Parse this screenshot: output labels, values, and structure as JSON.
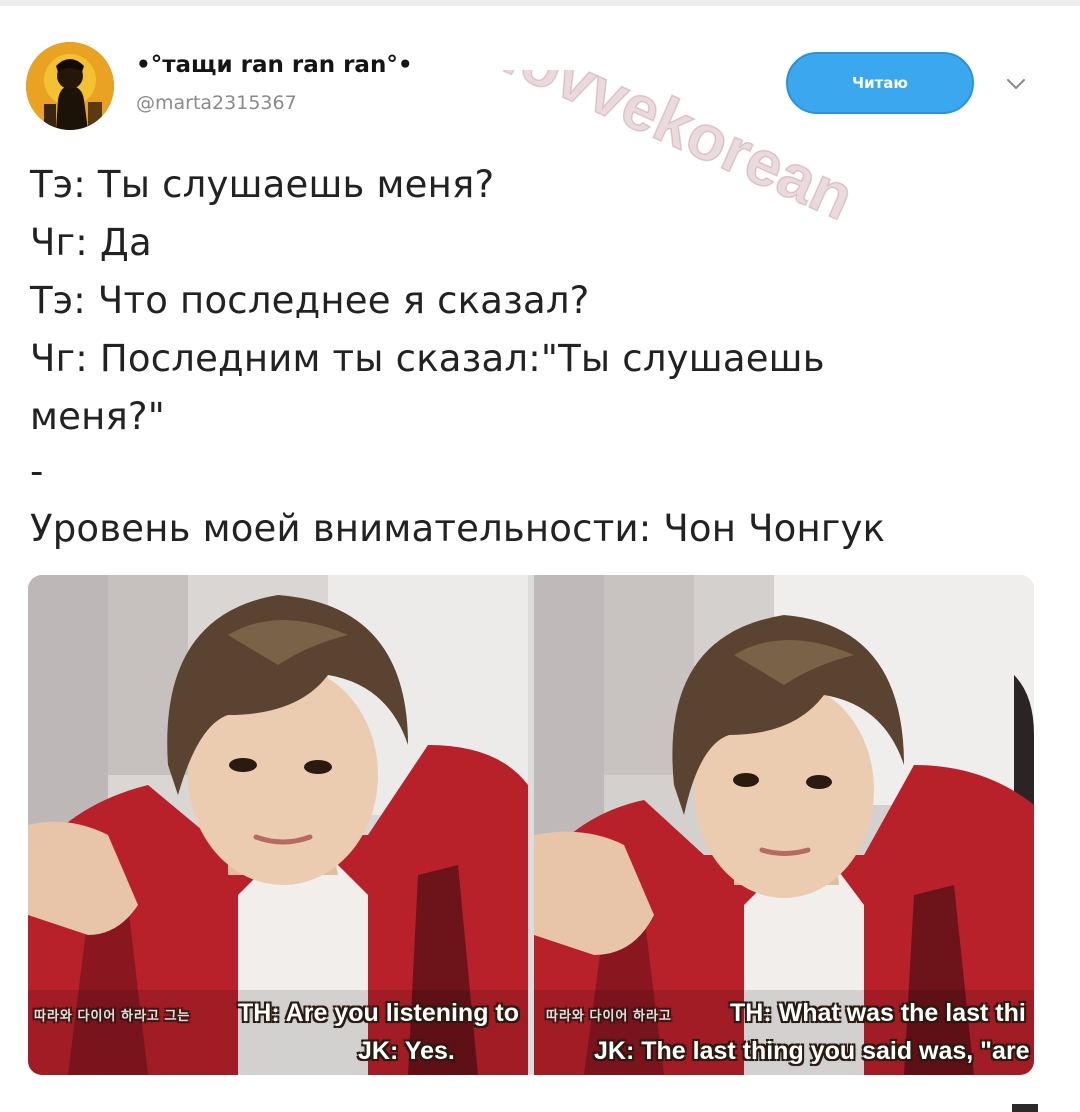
{
  "tweet": {
    "display_name": "•°тащи ran ran ran°•",
    "handle": "@marta2315367",
    "follow_button_label": "Читаю",
    "avatar_icon": "avatar-image",
    "menu_icon": "chevron-down-icon",
    "lines": [
      "Тэ: Ты слушаешь меня?",
      "Чг: Да",
      "Тэ: Что последнее я сказал?",
      "Чг: Последним ты сказал:\"Ты слушаешь",
      "меня?\"",
      "-",
      "Уровень моей внимательности: Чон Чонгук"
    ]
  },
  "media": {
    "frames": [
      {
        "korean_caption": "따라와 다이어 하라고 그는",
        "question": "TH: Are you listening to",
        "answer": "JK: Yes."
      },
      {
        "korean_caption": "따라와 다이어 하라고",
        "question": "TH: What was the last thi",
        "answer": "JK: The last thing you said was, \"are"
      }
    ]
  },
  "watermark": {
    "text": "vk.com/lovvekorean"
  },
  "colors": {
    "follow_button": "#3aa7ee",
    "handle": "#8a8a8a",
    "text": "#222222",
    "jacket": "#b8202a"
  }
}
